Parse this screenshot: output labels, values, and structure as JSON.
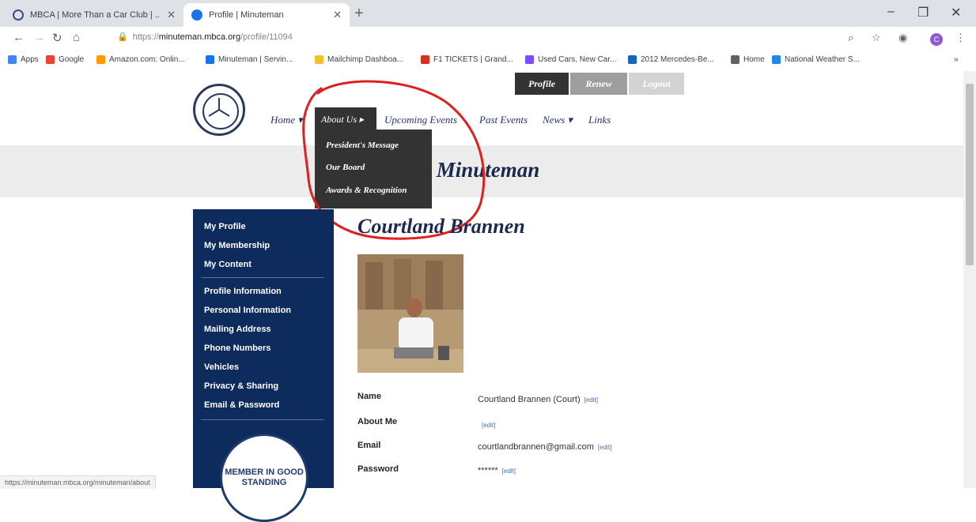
{
  "browser": {
    "tabs": [
      {
        "label": "MBCA | More Than a Car Club | ..",
        "icon": "mbca-favicon"
      },
      {
        "label": "Profile | Minuteman",
        "icon": "minuteman-favicon",
        "active": true
      }
    ],
    "url_prefix": "https://",
    "url_host": "minuteman.mbca.org",
    "url_path": "/profile/11094",
    "avatar_letter": "C",
    "bookmarks": [
      {
        "label": "Apps",
        "color": "#4285f4"
      },
      {
        "label": "Google",
        "color": "#ea4335"
      },
      {
        "label": "Amazon.com: Onlin...",
        "color": "#ff9900"
      },
      {
        "label": "Minuteman | Servin...",
        "color": "#1a73e8"
      },
      {
        "label": "Mailchimp Dashboa...",
        "color": "#f2c12e"
      },
      {
        "label": "F1 TICKETS | Grand...",
        "color": "#d93025"
      },
      {
        "label": "Used Cars, New Car...",
        "color": "#7c4dff"
      },
      {
        "label": "2012 Mercedes-Be...",
        "color": "#1565c0"
      },
      {
        "label": "Home",
        "color": "#5f6368"
      },
      {
        "label": "National Weather S...",
        "color": "#1e88e5"
      }
    ],
    "status_url": "https://minuteman.mbca.org/minuteman/about"
  },
  "site": {
    "nav": {
      "home": "Home ▾",
      "about": "About Us ▸",
      "upcoming": "Upcoming Events",
      "past": "Past Events",
      "news": "News ▾",
      "links": "Links"
    },
    "dropdown": [
      "President's Message",
      "Our Board",
      "Awards & Recognition"
    ],
    "top_buttons": {
      "profile": "Profile",
      "renew": "Renew",
      "logout": "Logout"
    },
    "banner_title": "Minuteman",
    "sidebar": {
      "group1": [
        "My Profile",
        "My Membership",
        "My Content"
      ],
      "group2": [
        "Profile Information",
        "Personal Information",
        "Mailing Address",
        "Phone Numbers",
        "Vehicles",
        "Privacy & Sharing",
        "Email & Password"
      ],
      "badge": "MEMBER IN GOOD STANDING"
    },
    "profile": {
      "name_heading": "Courtland Brannen",
      "fields": [
        {
          "label": "Name",
          "value": "Courtland Brannen (Court)",
          "edit": "[edit]"
        },
        {
          "label": "About Me",
          "value": "",
          "edit": "[edit]"
        },
        {
          "label": "Email",
          "value": "courtlandbrannen@gmail.com",
          "edit": "[edit]"
        },
        {
          "label": "Password",
          "value": "******",
          "edit": "[edit]"
        }
      ]
    }
  },
  "colors": {
    "navy": "#0d2b5c",
    "dark": "#333333",
    "annotation": "#e0201e"
  }
}
